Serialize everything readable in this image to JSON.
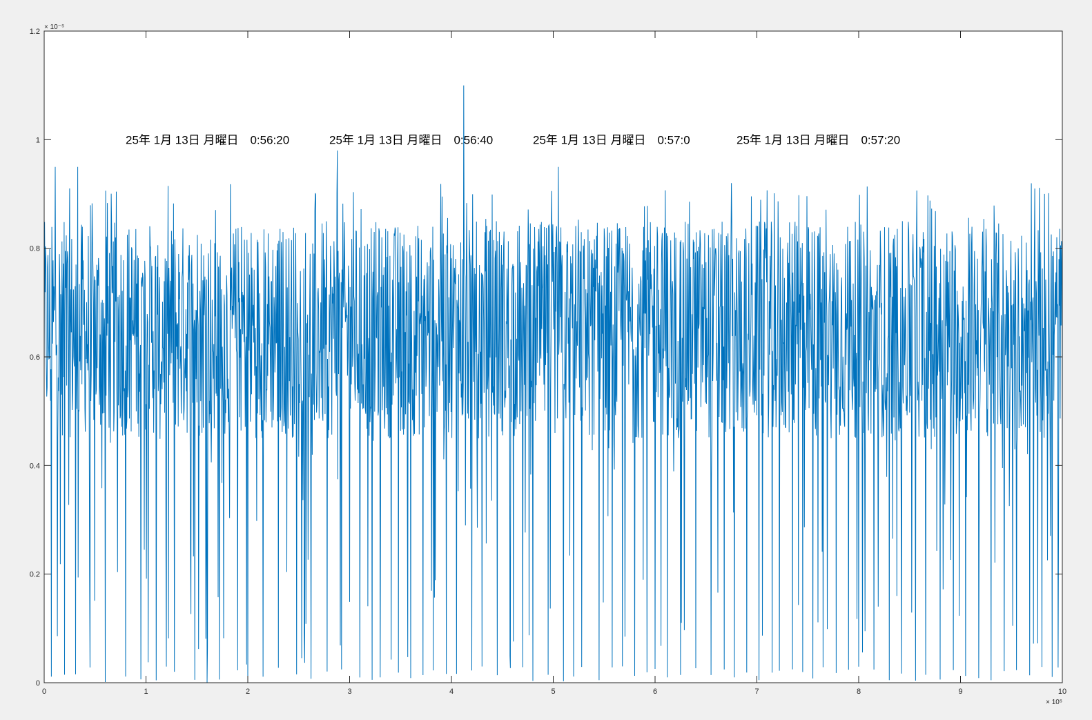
{
  "chart_data": {
    "type": "line",
    "title": "",
    "xlabel": "",
    "ylabel": "",
    "xlim": [
      0,
      1000000
    ],
    "ylim": [
      0,
      1.2e-05
    ],
    "grid": false,
    "legend": "none",
    "line_color": "#0072bd",
    "background": "#f0f0f0",
    "axes_color": "#ffffff",
    "x_ticks": [
      0,
      100000,
      200000,
      300000,
      400000,
      500000,
      600000,
      700000,
      800000,
      900000,
      1000000
    ],
    "x_tick_labels": [
      "0",
      "1",
      "2",
      "3",
      "4",
      "5",
      "6",
      "7",
      "8",
      "9",
      "10"
    ],
    "x_exponent_label": "× 10⁵",
    "y_ticks": [
      0,
      2e-06,
      4e-06,
      6e-06,
      8e-06,
      1e-05,
      1.2e-05
    ],
    "y_tick_labels": [
      "0",
      "0.2",
      "0.4",
      "0.6",
      "0.8",
      "1",
      "1.2"
    ],
    "y_exponent_label": "× 10⁻⁵",
    "annotations": [
      {
        "text": "25年 1月 13日 月曜日　0:56:20",
        "x": 80000,
        "y": 1e-05
      },
      {
        "text": "25年 1月 13日 月曜日　0:56:40",
        "x": 280000,
        "y": 1e-05
      },
      {
        "text": "25年 1月 13日 月曜日　0:57:0",
        "x": 480000,
        "y": 1e-05
      },
      {
        "text": "25年 1月 13日 月曜日　0:57:20",
        "x": 680000,
        "y": 1e-05
      }
    ],
    "series": [
      {
        "samples": 1000000,
        "typical_range": [
          4.5e-06,
          8.5e-06
        ],
        "peaks": [
          {
            "x": 11000,
            "y": 9.5e-06
          },
          {
            "x": 33000,
            "y": 9.5e-06
          },
          {
            "x": 288000,
            "y": 9.8e-06
          },
          {
            "x": 412000,
            "y": 1.1e-05
          },
          {
            "x": 505000,
            "y": 9.5e-06
          },
          {
            "x": 675000,
            "y": 9.2e-06
          },
          {
            "x": 973000,
            "y": 9.1e-06
          }
        ],
        "dropouts_to_zero": [
          7000,
          20000,
          31000,
          45000,
          60000,
          80000,
          95000,
          110000,
          120000,
          128000,
          148000,
          160000,
          172000,
          190000,
          200000,
          215000,
          230000,
          248000,
          262000,
          278000,
          292000,
          310000,
          322000,
          330000,
          348000,
          360000,
          372000,
          382000,
          395000,
          405000,
          420000,
          430000,
          445000,
          458000,
          470000,
          480000,
          495000,
          510000,
          520000,
          528000,
          545000,
          558000,
          568000,
          580000,
          592000,
          600000,
          612000,
          625000,
          640000,
          655000,
          668000,
          678000,
          690000,
          702000,
          715000,
          722000,
          735000,
          745000,
          755000,
          765000,
          778000,
          790000,
          800000,
          815000,
          830000,
          842000,
          856000,
          866000,
          880000,
          893000,
          905000,
          918000,
          930000,
          943000,
          955000,
          968000,
          980000,
          990000,
          996000
        ]
      }
    ]
  }
}
